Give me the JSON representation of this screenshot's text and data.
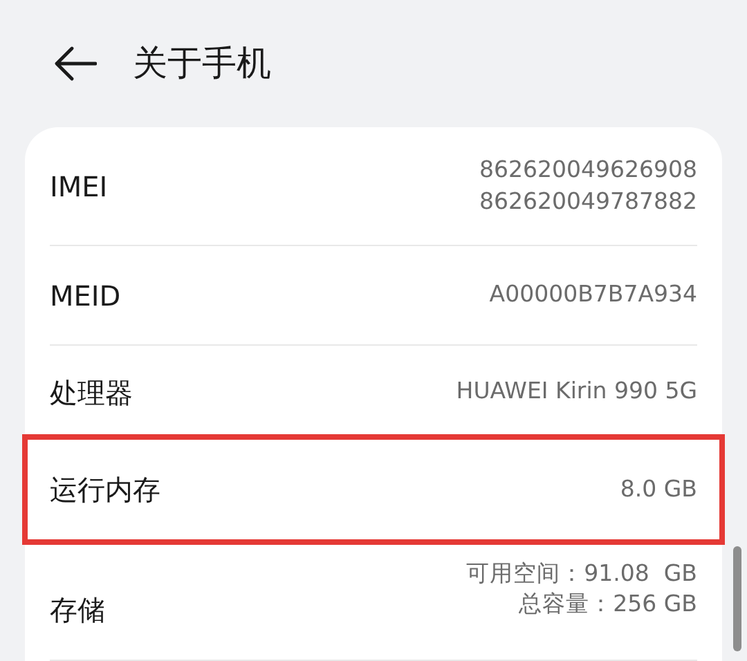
{
  "header": {
    "title": "关于手机"
  },
  "rows": [
    {
      "label": "IMEI",
      "values": [
        "862620049626908",
        "862620049787882"
      ],
      "highlighted": false
    },
    {
      "label": "MEID",
      "values": [
        "A00000B7B7A934"
      ],
      "highlighted": false
    },
    {
      "label": "处理器",
      "values": [
        "HUAWEI Kirin 990 5G"
      ],
      "highlighted": false
    },
    {
      "label": "运行内存",
      "values": [
        "8.0 GB"
      ],
      "highlighted": true
    },
    {
      "label": "存储",
      "values": [
        "可用空间：91.08  GB",
        "总容量：256 GB"
      ],
      "highlighted": false
    }
  ]
}
